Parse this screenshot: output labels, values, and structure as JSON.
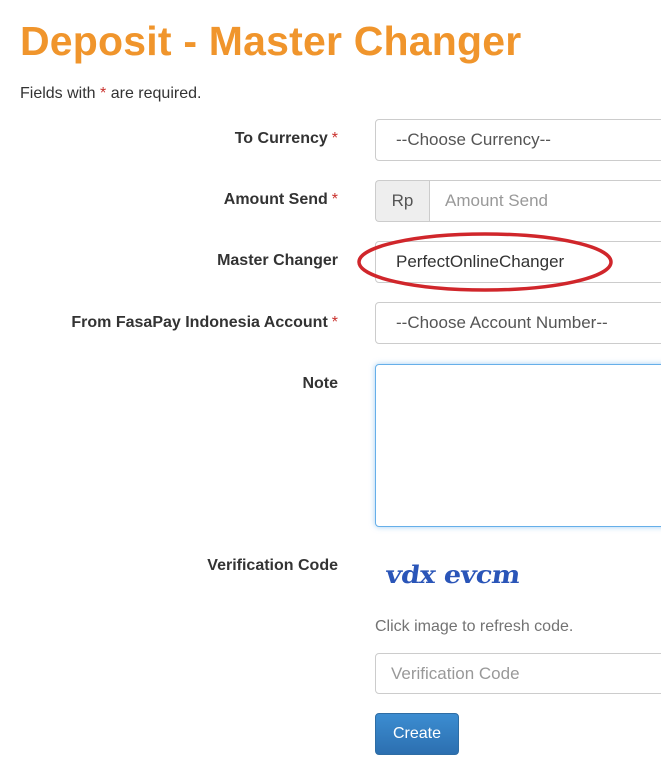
{
  "page": {
    "title": "Deposit - Master Changer",
    "required_note_prefix": "Fields with",
    "required_note_star": "*",
    "required_note_suffix": "are required."
  },
  "form": {
    "to_currency": {
      "label": "To Currency",
      "required_mark": "*",
      "selected": "--Choose Currency--"
    },
    "amount_send": {
      "label": "Amount Send",
      "required_mark": "*",
      "addon": "Rp",
      "placeholder": "Amount Send",
      "value": ""
    },
    "master_changer": {
      "label": "Master Changer",
      "value": "PerfectOnlineChanger"
    },
    "from_account": {
      "label": "From FasaPay Indonesia Account",
      "required_mark": "*",
      "selected": "--Choose Account Number--"
    },
    "note": {
      "label": "Note",
      "value": ""
    },
    "verification": {
      "label": "Verification Code",
      "captcha_text": "vdx evcm",
      "hint": "Click image to refresh code.",
      "placeholder": "Verification Code",
      "value": ""
    },
    "submit_label": "Create"
  },
  "colors": {
    "title": "#f0952c",
    "required": "#c9302c",
    "primary_button": "#337ab7",
    "annotation": "#d0262b"
  }
}
